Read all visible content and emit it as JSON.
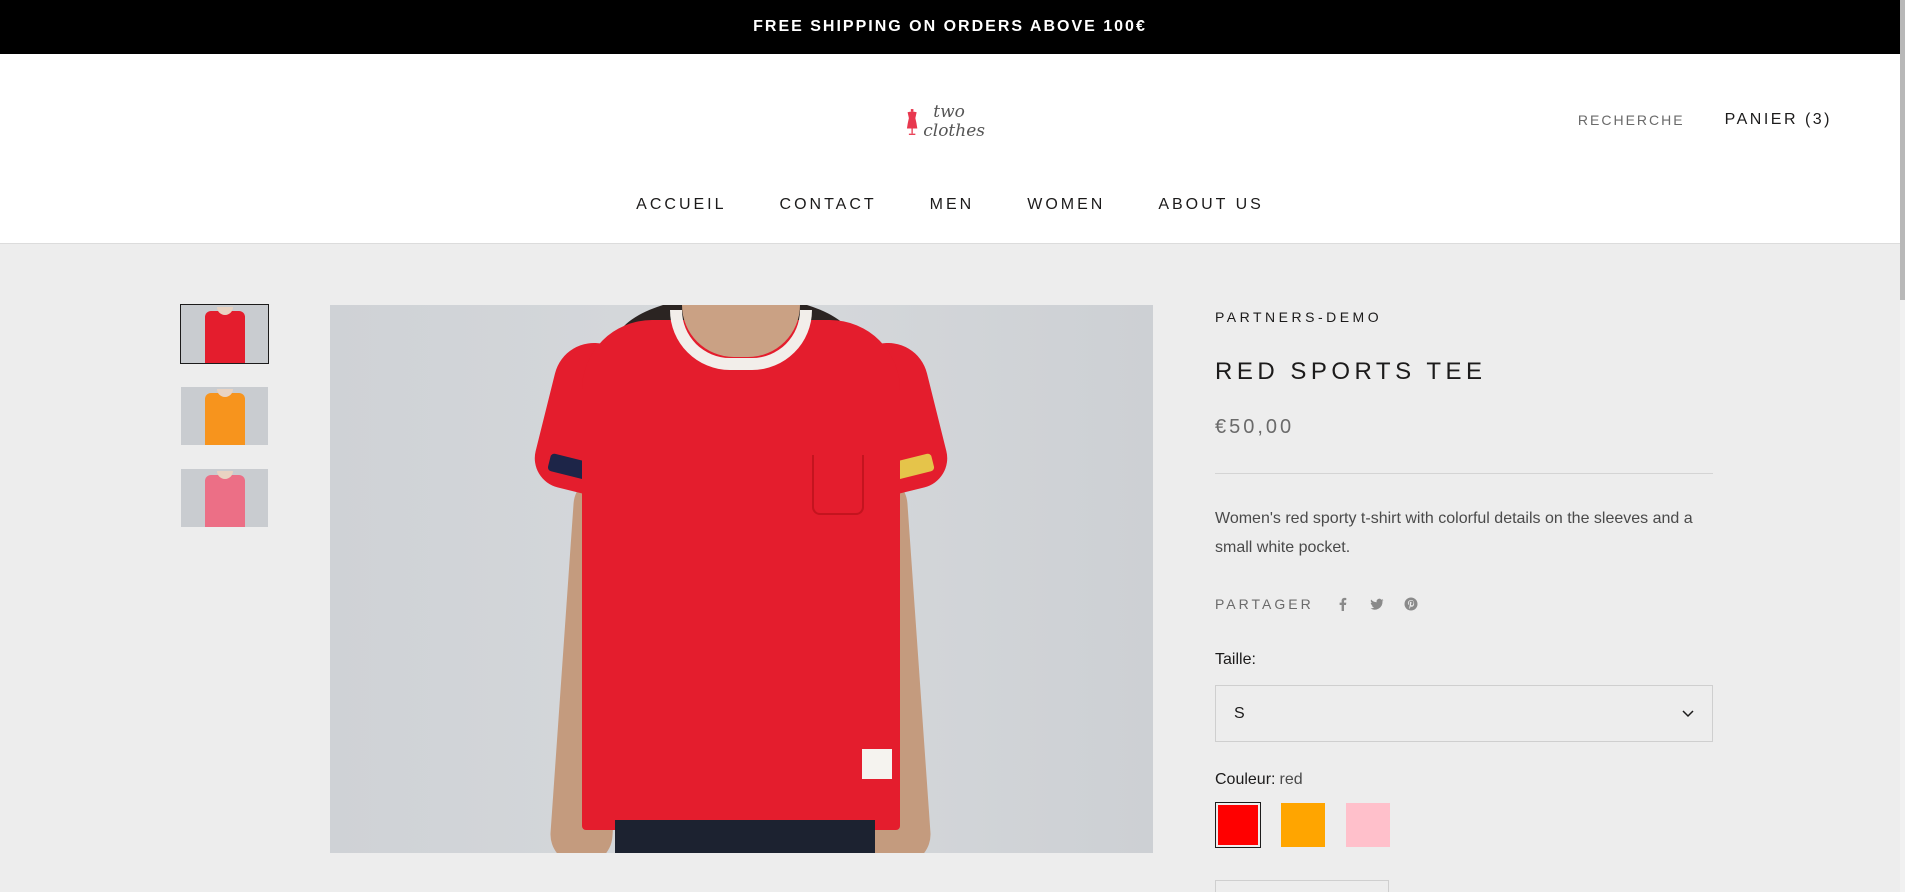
{
  "announcement": {
    "text": "FREE SHIPPING ON ORDERS ABOVE 100€"
  },
  "header": {
    "logo_line1": "two",
    "logo_line2": "clothes",
    "search_label": "RECHERCHE",
    "cart_label": "PANIER (3)"
  },
  "nav": {
    "items": [
      {
        "label": "ACCUEIL"
      },
      {
        "label": "CONTACT"
      },
      {
        "label": "MEN"
      },
      {
        "label": "WOMEN"
      },
      {
        "label": "ABOUT US"
      }
    ]
  },
  "product": {
    "vendor": "PARTNERS-DEMO",
    "title": "RED SPORTS TEE",
    "price": "€50,00",
    "description": "Women's red sporty t-shirt with colorful details on the sleeves and a small white pocket.",
    "share_label": "PARTAGER",
    "share_icons": [
      "facebook-icon",
      "twitter-icon",
      "pinterest-icon"
    ],
    "size_label": "Taille:",
    "size_value": "S",
    "color_label": "Couleur:",
    "color_value": "red",
    "swatches": [
      {
        "name": "red",
        "hex": "#ff0000",
        "selected": true
      },
      {
        "name": "orange",
        "hex": "#ffa500",
        "selected": false
      },
      {
        "name": "pink",
        "hex": "#ffc0cb",
        "selected": false
      }
    ],
    "thumbnails": [
      {
        "color": "#e41d2d",
        "active": true
      },
      {
        "color": "#f7941d",
        "active": false
      },
      {
        "color": "#ec6f86",
        "active": false
      }
    ]
  },
  "colors": {
    "announcement_bg": "#000000",
    "page_bg": "#ededed",
    "text": "#1c1b1b",
    "muted": "#6a6a6a"
  }
}
